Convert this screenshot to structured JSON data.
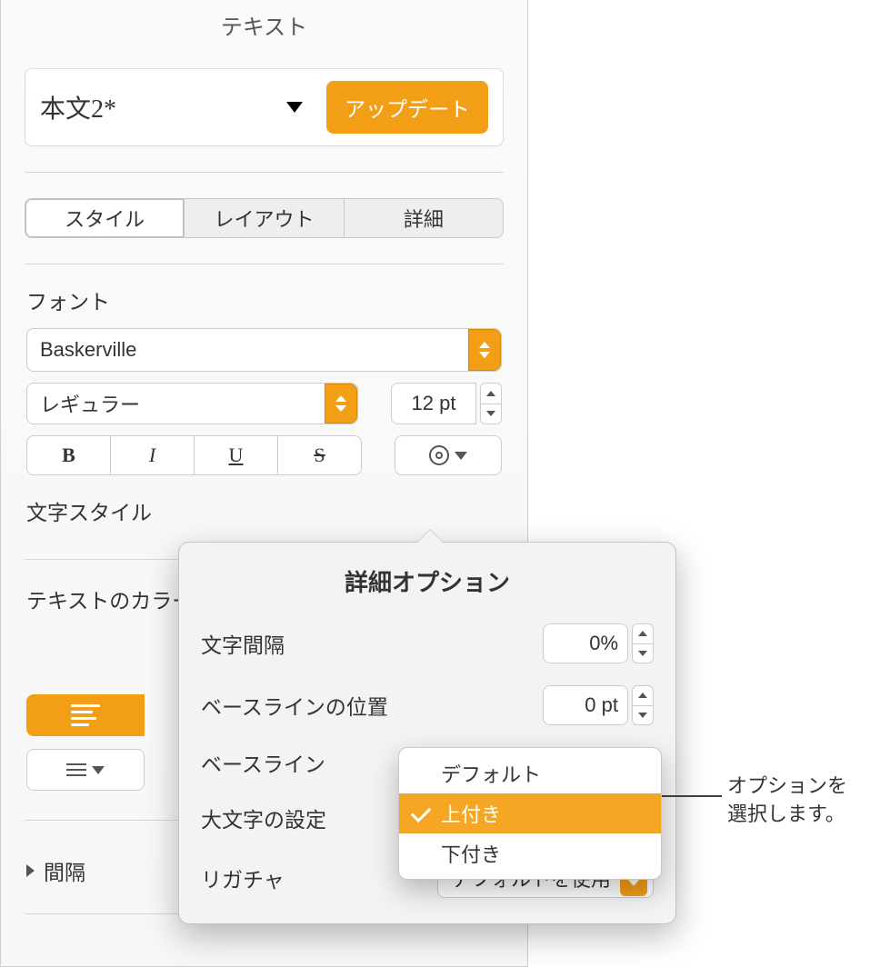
{
  "header": {
    "title": "テキスト"
  },
  "style_selector": {
    "name": "本文2*",
    "update_label": "アップデート"
  },
  "tabs": {
    "style": "スタイル",
    "layout": "レイアウト",
    "more": "詳細"
  },
  "font": {
    "section_label": "フォント",
    "family": "Baskerville",
    "weight": "レギュラー",
    "size": "12 pt"
  },
  "char_style_label": "文字スタイル",
  "text_color_label": "テキストのカラー",
  "spacing_label": "間隔",
  "popover": {
    "title": "詳細オプション",
    "char_spacing_label": "文字間隔",
    "char_spacing_value": "0%",
    "baseline_shift_label": "ベースラインの位置",
    "baseline_shift_value": "0 pt",
    "baseline_label": "ベースライン",
    "caps_label": "大文字の設定",
    "ligature_label": "リガチャ",
    "ligature_value": "デフォルトを使用"
  },
  "baseline_menu": {
    "default": "デフォルト",
    "superscript": "上付き",
    "subscript": "下付き"
  },
  "callout": {
    "line1": "オプションを",
    "line2": "選択します。"
  }
}
